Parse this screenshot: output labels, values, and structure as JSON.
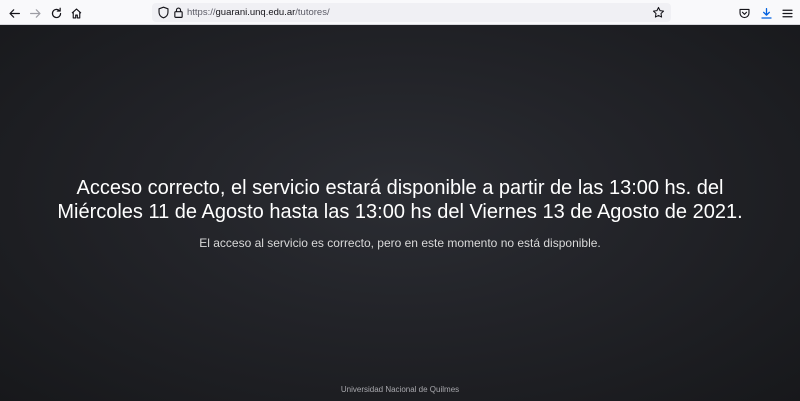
{
  "browser": {
    "url_scheme": "https://",
    "url_host": "guarani.unq.edu.ar",
    "url_path": "/tutores/",
    "icons": {
      "back": "arrow-left-icon",
      "forward": "arrow-right-icon",
      "reload": "reload-icon",
      "home": "home-icon",
      "tracking": "shield-icon",
      "lock": "lock-icon",
      "bookmark": "star-icon",
      "pocket": "pocket-icon",
      "downloads": "download-icon",
      "menu": "hamburger-menu-icon"
    },
    "accent": "#0060df"
  },
  "page": {
    "title_line1": "Acceso correcto, el servicio estará disponible a partir de las 13:00 hs. del",
    "title_line2": "Miércoles 11 de Agosto hasta las 13:00 hs del Viernes 13 de Agosto de 2021.",
    "subtitle": "El acceso al servicio es correcto, pero en este momento no está disponible.",
    "footer": "Universidad Nacional de Quilmes"
  }
}
